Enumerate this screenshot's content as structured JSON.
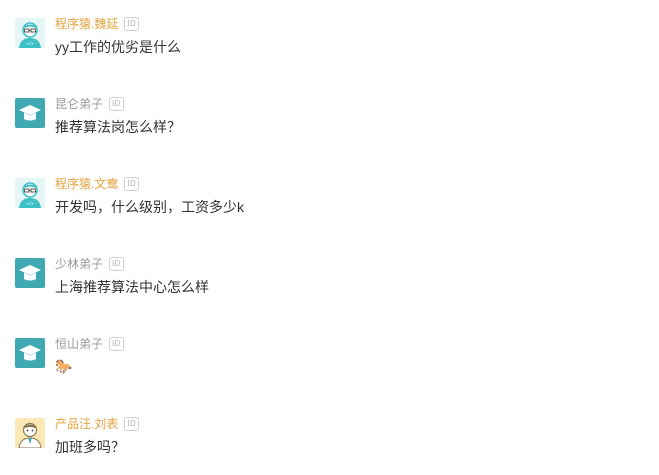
{
  "colors": {
    "highlight_name": "#e3a23c",
    "regular_name": "#999999",
    "message_text": "#333333",
    "teal_avatar": "#3fa9b3"
  },
  "comments": [
    {
      "username": "程序猿.魏延",
      "badge": "ID",
      "message": "yy工作的优劣是什么",
      "avatar_icon": "programmer-avatar-icon",
      "highlight": true
    },
    {
      "username": "昆仑弟子",
      "badge": "ID",
      "message": "推荐算法岗怎么样？",
      "avatar_icon": "graduation-cap-avatar-icon",
      "highlight": false
    },
    {
      "username": "程序猿.文鸯",
      "badge": "ID",
      "message": "开发吗，什么级别，工资多少k",
      "avatar_icon": "programmer-avatar-icon",
      "highlight": true
    },
    {
      "username": "少林弟子",
      "badge": "ID",
      "message": "上海推荐算法中心怎么样",
      "avatar_icon": "graduation-cap-avatar-icon",
      "highlight": false
    },
    {
      "username": "恒山弟子",
      "badge": "ID",
      "message": "🐎",
      "avatar_icon": "graduation-cap-avatar-icon",
      "highlight": false
    },
    {
      "username": "产品汪.刘表",
      "badge": "ID",
      "message": "加班多吗？",
      "avatar_icon": "product-manager-avatar-icon",
      "highlight": true
    }
  ]
}
